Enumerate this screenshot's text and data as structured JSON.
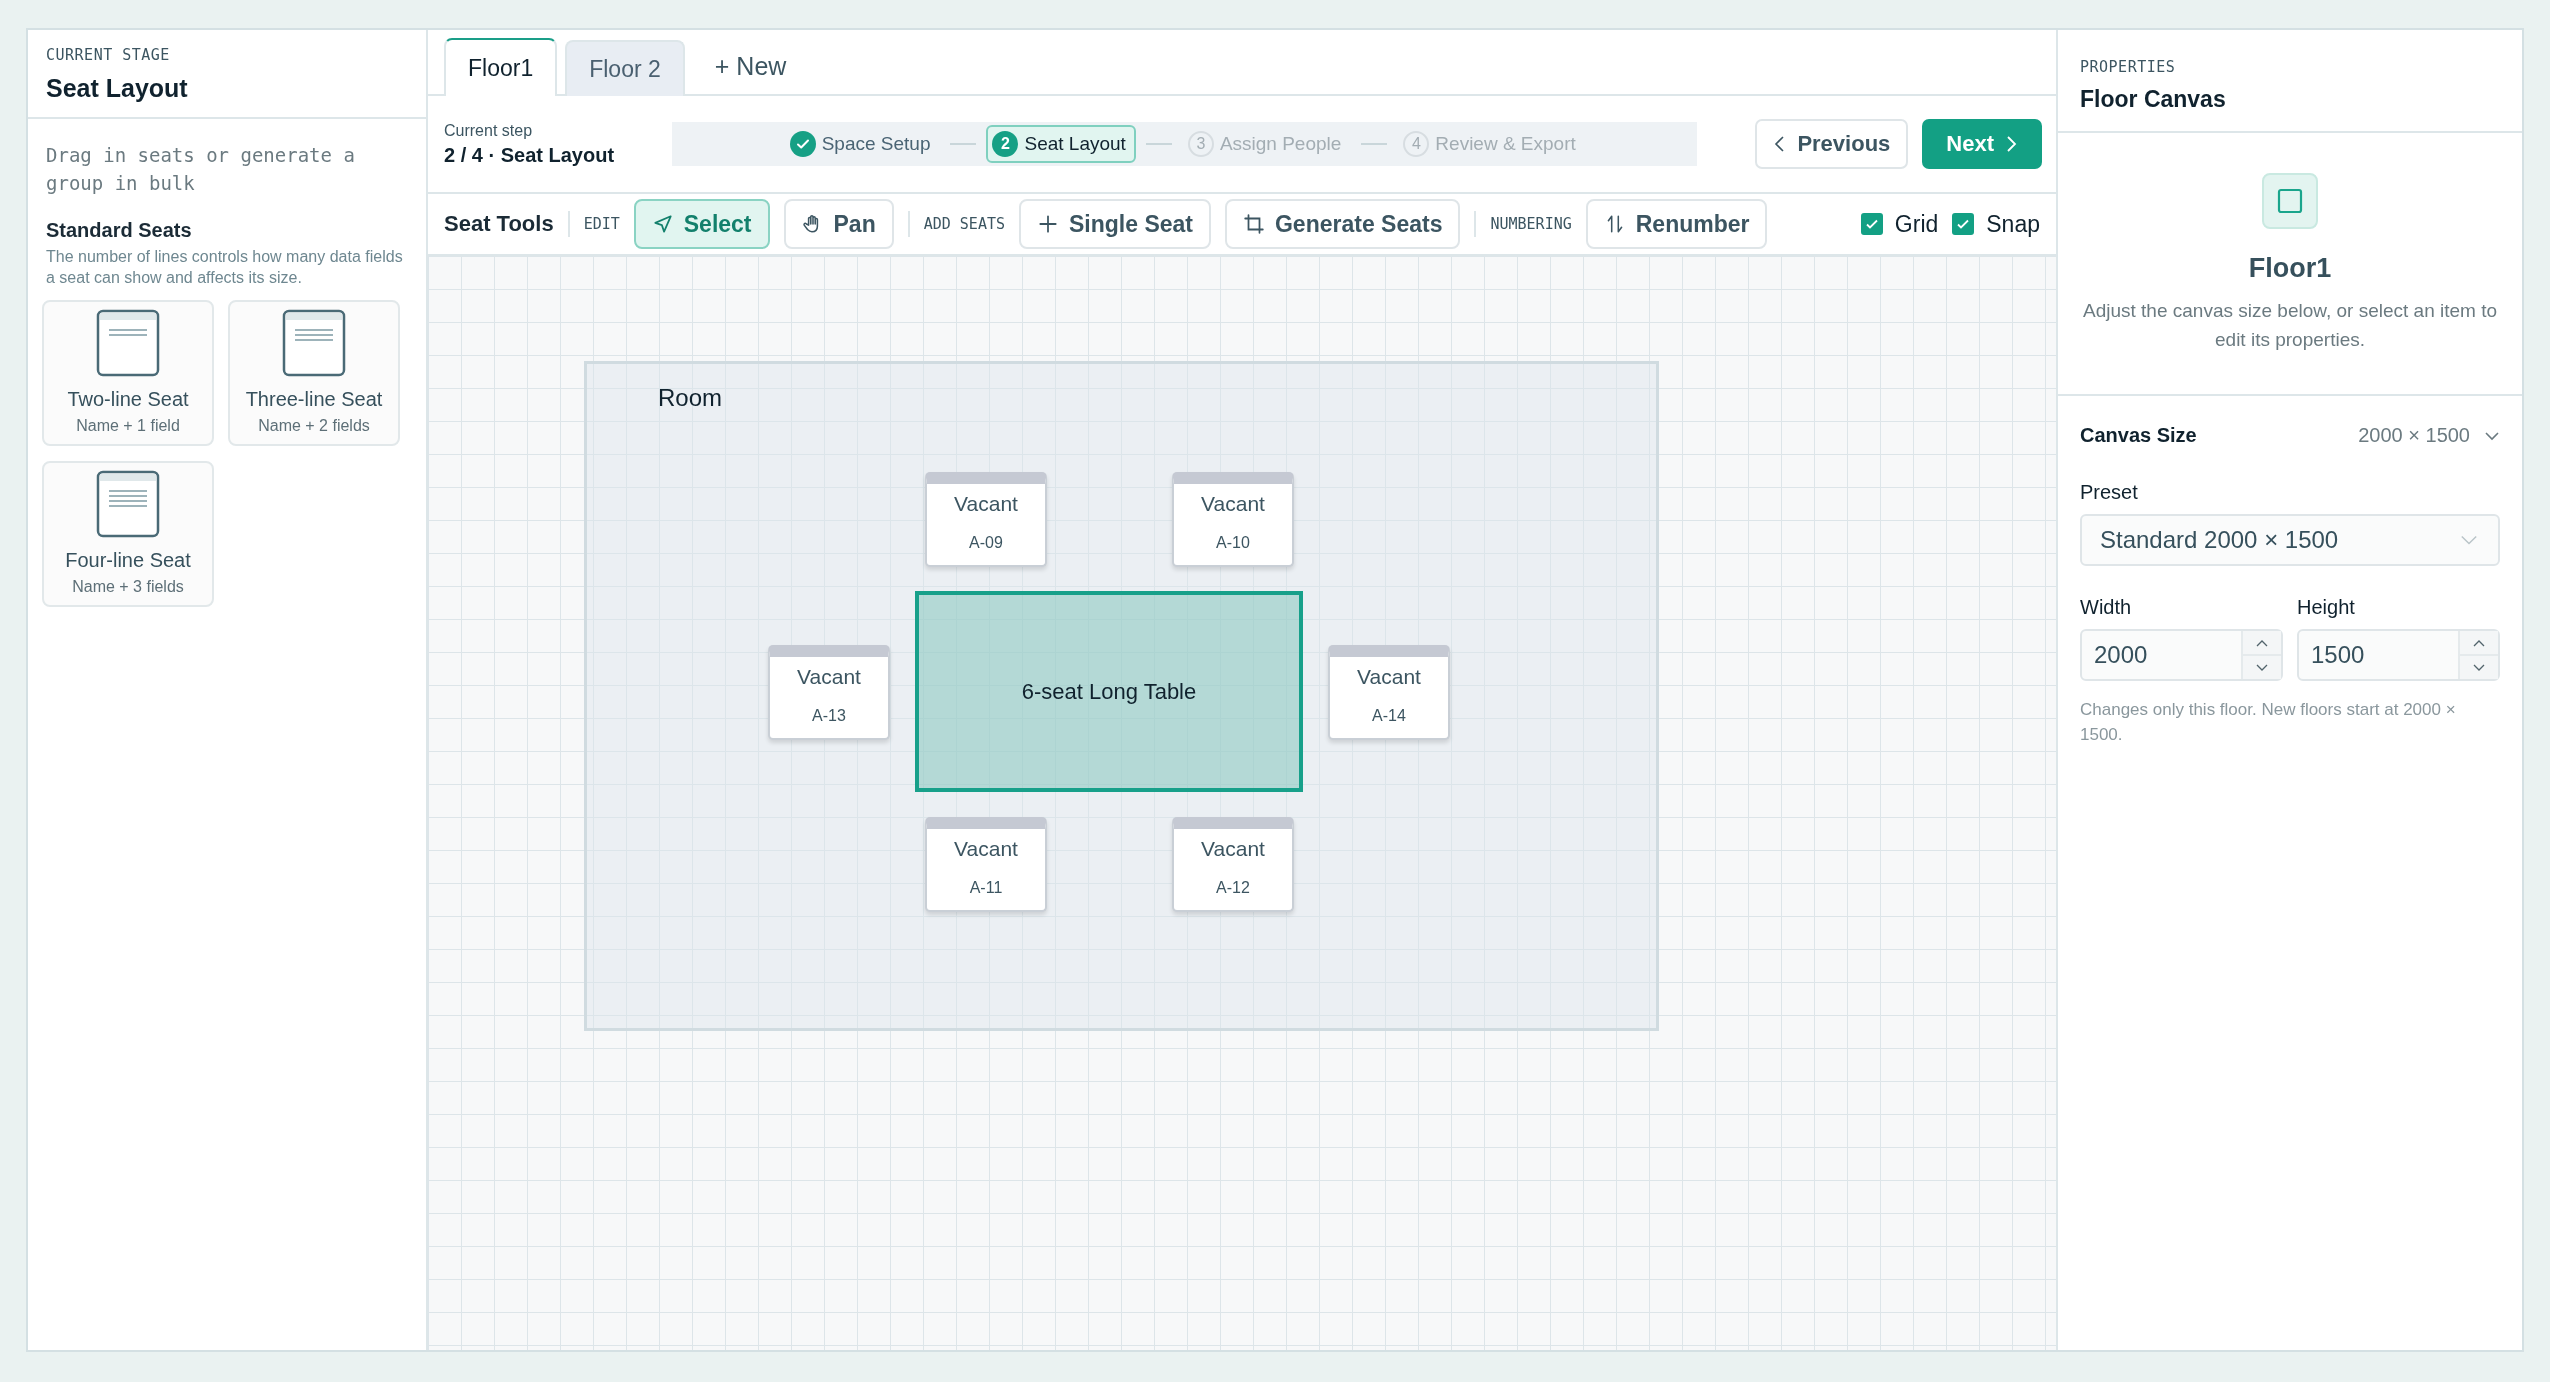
{
  "sidebar": {
    "eyebrow": "CURRENT STAGE",
    "title": "Seat Layout",
    "hint": "Drag in seats or generate a group in bulk",
    "section_title": "Standard Seats",
    "section_desc": "The number of lines controls how many data fields a seat can show and affects its size.",
    "templates": [
      {
        "name": "Two-line Seat",
        "detail": "Name + 1 field"
      },
      {
        "name": "Three-line Seat",
        "detail": "Name + 2 fields"
      },
      {
        "name": "Four-line Seat",
        "detail": "Name + 3 fields"
      }
    ]
  },
  "tabs": [
    {
      "label": "Floor1",
      "selected": true
    },
    {
      "label": "Floor 2",
      "selected": false
    }
  ],
  "new_tab": "+ New",
  "step_info": {
    "label": "Current step",
    "value": "2 / 4 · Seat Layout"
  },
  "steps": [
    {
      "label": "Space Setup",
      "completed": true,
      "selected": false
    },
    {
      "number": "2",
      "label": "Seat Layout",
      "completed": false,
      "selected": true
    },
    {
      "number": "3",
      "label": "Assign People",
      "completed": false,
      "selected": false
    },
    {
      "number": "4",
      "label": "Review & Export",
      "completed": false,
      "selected": false
    }
  ],
  "nav": {
    "previous": "Previous",
    "next": "Next"
  },
  "toolbar": {
    "title": "Seat Tools",
    "groups": [
      {
        "label": "EDIT",
        "tools": [
          {
            "label": "Select",
            "selected": true
          },
          {
            "label": "Pan",
            "selected": false
          }
        ]
      },
      {
        "label": "ADD SEATS",
        "tools": [
          {
            "label": "Single Seat",
            "selected": false
          },
          {
            "label": "Generate Seats",
            "selected": false
          }
        ]
      },
      {
        "label": "NUMBERING",
        "tools": [
          {
            "label": "Renumber",
            "selected": false
          }
        ]
      }
    ],
    "toggles": [
      {
        "label": "Grid",
        "checked": true
      },
      {
        "label": "Snap",
        "checked": true
      }
    ]
  },
  "canvas": {
    "room": "Room",
    "table": {
      "label": "6-seat Long Table",
      "selected": true
    },
    "seats": [
      {
        "name": "Vacant",
        "code": "A-09"
      },
      {
        "name": "Vacant",
        "code": "A-10"
      },
      {
        "name": "Vacant",
        "code": "A-13"
      },
      {
        "name": "Vacant",
        "code": "A-14"
      },
      {
        "name": "Vacant",
        "code": "A-11"
      },
      {
        "name": "Vacant",
        "code": "A-12"
      }
    ]
  },
  "properties": {
    "eyebrow": "PROPERTIES",
    "title": "Floor Canvas",
    "name": "Floor1",
    "desc": "Adjust the canvas size below, or select an item to edit its properties.",
    "canvas_size": {
      "label": "Canvas Size",
      "value": "2000 × 1500",
      "expanded": true
    },
    "preset": {
      "label": "Preset",
      "value": "Standard 2000 × 1500"
    },
    "width": {
      "label": "Width",
      "value": "2000"
    },
    "height": {
      "label": "Height",
      "value": "1500"
    },
    "note": "Changes only this floor. New floors start at 2000 × 1500."
  }
}
